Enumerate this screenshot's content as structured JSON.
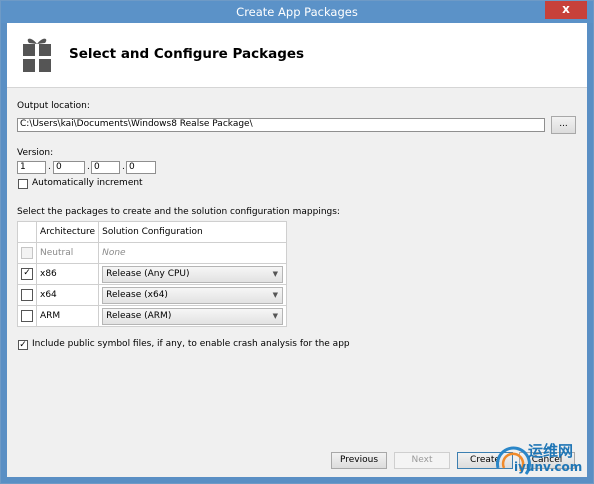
{
  "window": {
    "title": "Create App Packages",
    "close_glyph": "x"
  },
  "header": {
    "title": "Select and Configure Packages"
  },
  "output": {
    "label": "Output location:",
    "value": "C:\\Users\\kai\\Documents\\Windows8 Realse Package\\",
    "browse_label": "..."
  },
  "version": {
    "label": "Version:",
    "parts": [
      "1",
      "0",
      "0",
      "0"
    ],
    "separator": ".",
    "auto_increment_label": "Automatically increment",
    "auto_increment_checked": false
  },
  "packages": {
    "prompt": "Select the packages to create and the solution configuration mappings:",
    "columns": [
      "Architecture",
      "Solution Configuration"
    ],
    "rows": [
      {
        "arch": "Neutral",
        "config": "None",
        "checked": false,
        "enabled": false
      },
      {
        "arch": "x86",
        "config": "Release (Any CPU)",
        "checked": true,
        "enabled": true
      },
      {
        "arch": "x64",
        "config": "Release (x64)",
        "checked": false,
        "enabled": true
      },
      {
        "arch": "ARM",
        "config": "Release (ARM)",
        "checked": false,
        "enabled": true
      }
    ]
  },
  "symbols": {
    "label": "Include public symbol files, if any, to enable crash analysis for the app",
    "checked": true
  },
  "buttons": {
    "previous": "Previous",
    "next": "Next",
    "create": "Create",
    "cancel": "Cancel"
  },
  "watermark": {
    "text1": "运维网",
    "text2": "iyunv.com"
  }
}
